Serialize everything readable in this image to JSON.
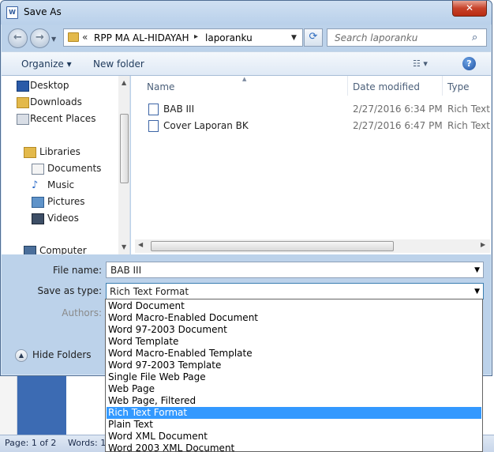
{
  "window": {
    "title": "Save As",
    "close_label": "✕"
  },
  "address": {
    "chevron": "«",
    "segment1": "RPP MA AL-HIDAYAH",
    "separator": "▸",
    "segment2": "laporanku"
  },
  "search": {
    "placeholder": "Search laporanku"
  },
  "toolbar": {
    "organize_label": "Organize ▾",
    "new_folder_label": "New folder",
    "help_label": "?"
  },
  "nav": {
    "items": [
      {
        "label": "Desktop",
        "icon": "desktop-icon"
      },
      {
        "label": "Downloads",
        "icon": "downloads-icon"
      },
      {
        "label": "Recent Places",
        "icon": "recent-places-icon"
      },
      {
        "label": "Libraries",
        "icon": "libraries-icon"
      },
      {
        "label": "Documents",
        "icon": "documents-icon"
      },
      {
        "label": "Music",
        "icon": "music-icon"
      },
      {
        "label": "Pictures",
        "icon": "pictures-icon"
      },
      {
        "label": "Videos",
        "icon": "videos-icon"
      },
      {
        "label": "Computer",
        "icon": "computer-icon"
      }
    ]
  },
  "files": {
    "columns": [
      "Name",
      "Date modified",
      "Type"
    ],
    "rows": [
      {
        "name": "BAB III",
        "date": "2/27/2016 6:34 PM",
        "type": "Rich Text"
      },
      {
        "name": "Cover Laporan BK",
        "date": "2/27/2016 6:47 PM",
        "type": "Rich Text"
      }
    ]
  },
  "form": {
    "filename_label": "File name:",
    "filename_value": "BAB III",
    "savetype_label": "Save as type:",
    "savetype_value": "Rich Text Format",
    "authors_label": "Authors:"
  },
  "hide_folders_label": "Hide Folders",
  "type_options": [
    "Word Document",
    "Word Macro-Enabled Document",
    "Word 97-2003 Document",
    "Word Template",
    "Word Macro-Enabled Template",
    "Word 97-2003 Template",
    "Single File Web Page",
    "Web Page",
    "Web Page, Filtered",
    "Rich Text Format",
    "Plain Text",
    "Word XML Document",
    "Word 2003 XML Document"
  ],
  "selected_option": "Rich Text Format",
  "statusbar": {
    "page": "Page: 1 of 2",
    "words": "Words: 1"
  },
  "colors": {
    "selection": "#3399ff",
    "titlebar": "#b9d0ea"
  }
}
